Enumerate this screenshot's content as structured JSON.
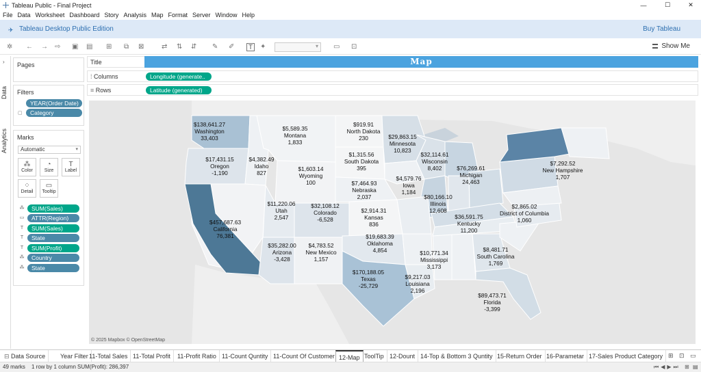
{
  "window": {
    "title": "Tableau Public - Final Project",
    "minimize": "—",
    "maximize": "☐",
    "close": "✕"
  },
  "menu": [
    "File",
    "Data",
    "Worksheet",
    "Dashboard",
    "Story",
    "Analysis",
    "Map",
    "Format",
    "Server",
    "Window",
    "Help"
  ],
  "banner": {
    "edition": "Tableau Desktop Public Edition",
    "buy": "Buy Tableau"
  },
  "toolbar": {
    "show_me": "Show Me"
  },
  "side_tabs": {
    "data": "Data",
    "analytics": "Analytics"
  },
  "pages": {
    "title": "Pages"
  },
  "filters": {
    "title": "Filters",
    "items": [
      "YEAR(Order Date)",
      "Category"
    ]
  },
  "marks": {
    "title": "Marks",
    "type": "Automatic",
    "buttons": [
      "Color",
      "Size",
      "Label",
      "Detail",
      "Tooltip"
    ],
    "fields": [
      {
        "icon": "color-icon",
        "label": "SUM(Sales)",
        "color": "green"
      },
      {
        "icon": "tooltip-icon",
        "label": "ATTR(Region)",
        "color": "blue"
      },
      {
        "icon": "label-icon",
        "label": "SUM(Sales)",
        "color": "green"
      },
      {
        "icon": "label-icon",
        "label": "State",
        "color": "blue"
      },
      {
        "icon": "label-icon",
        "label": "SUM(Profit)",
        "color": "green"
      },
      {
        "icon": "detail-icon",
        "label": "Country",
        "color": "blue"
      },
      {
        "icon": "detail-icon",
        "label": "State",
        "color": "blue"
      }
    ]
  },
  "shelves": {
    "title_label": "Title",
    "title_text": "Map",
    "columns_label": "Columns",
    "columns_pill": "Longitude (generate..",
    "rows_label": "Rows",
    "rows_pill": "Latitude (generated)"
  },
  "map": {
    "attribution": "© 2025 Mapbox © OpenStreetMap",
    "states": [
      {
        "sales": "$138,641.27",
        "name": "Washington",
        "profit": "33,403"
      },
      {
        "sales": "$5,589.35",
        "name": "Montana",
        "profit": "1,833"
      },
      {
        "sales": "$919.91",
        "name": "North Dakota",
        "profit": "230"
      },
      {
        "sales": "$29,863.15",
        "name": "Minnesota",
        "profit": "10,823"
      },
      {
        "sales": "$17,431.15",
        "name": "Oregon",
        "profit": "-1,190"
      },
      {
        "sales": "$4,382.49",
        "name": "Idaho",
        "profit": "827"
      },
      {
        "sales": "$1,603.14",
        "name": "Wyoming",
        "profit": "100"
      },
      {
        "sales": "$1,315.56",
        "name": "South Dakota",
        "profit": "395"
      },
      {
        "sales": "$32,114.61",
        "name": "Wisconsin",
        "profit": "8,402"
      },
      {
        "sales": "$76,269.61",
        "name": "Michigan",
        "profit": "24,463"
      },
      {
        "sales": "$7,292.52",
        "name": "New Hampshire",
        "profit": "1,707"
      },
      {
        "sales": "$7,464.93",
        "name": "Nebraska",
        "profit": "2,037"
      },
      {
        "sales": "$4,579.76",
        "name": "Iowa",
        "profit": "1,184"
      },
      {
        "sales": "$11,220.06",
        "name": "Utah",
        "profit": "2,547"
      },
      {
        "sales": "$32,108.12",
        "name": "Colorado",
        "profit": "-6,528"
      },
      {
        "sales": "$2,914.31",
        "name": "Kansas",
        "profit": "836"
      },
      {
        "sales": "$80,166.10",
        "name": "Illinois",
        "profit": "12,608"
      },
      {
        "sales": "$2,865.02",
        "name": "District of Columbia",
        "profit": "1,060"
      },
      {
        "sales": "$457,687.63",
        "name": "California",
        "profit": "76,381"
      },
      {
        "sales": "$36,591.75",
        "name": "Kentucky",
        "profit": "11,200"
      },
      {
        "sales": "$19,683.39",
        "name": "Oklahoma",
        "profit": "4,854"
      },
      {
        "sales": "$35,282.00",
        "name": "Arizona",
        "profit": "-3,428"
      },
      {
        "sales": "$4,783.52",
        "name": "New Mexico",
        "profit": "1,157"
      },
      {
        "sales": "$10,771.34",
        "name": "Mississippi",
        "profit": "3,173"
      },
      {
        "sales": "$8,481.71",
        "name": "South Carolina",
        "profit": "1,769"
      },
      {
        "sales": "$170,188.05",
        "name": "Texas",
        "profit": "-25,729"
      },
      {
        "sales": "$9,217.03",
        "name": "Louisiana",
        "profit": "2,196"
      },
      {
        "sales": "$89,473.71",
        "name": "Florida",
        "profit": "-3,399"
      }
    ]
  },
  "sheet_tabs": [
    "Data Source",
    "Year Filter",
    "11-Total Sales",
    "11-Total Profit",
    "11-Profit Ratio",
    "11-Count Quntity",
    "11-Count Of Customer",
    "12-Map",
    "ToolTip",
    "12-Dount",
    "14-Top & Bottom 3 Quntity",
    "15-Return Order",
    "16-Parametar",
    "17-Sales Product Category"
  ],
  "status": {
    "marks": "49 marks",
    "rows": "1 row by 1 column",
    "sum": "SUM(Profit): 286,397"
  }
}
